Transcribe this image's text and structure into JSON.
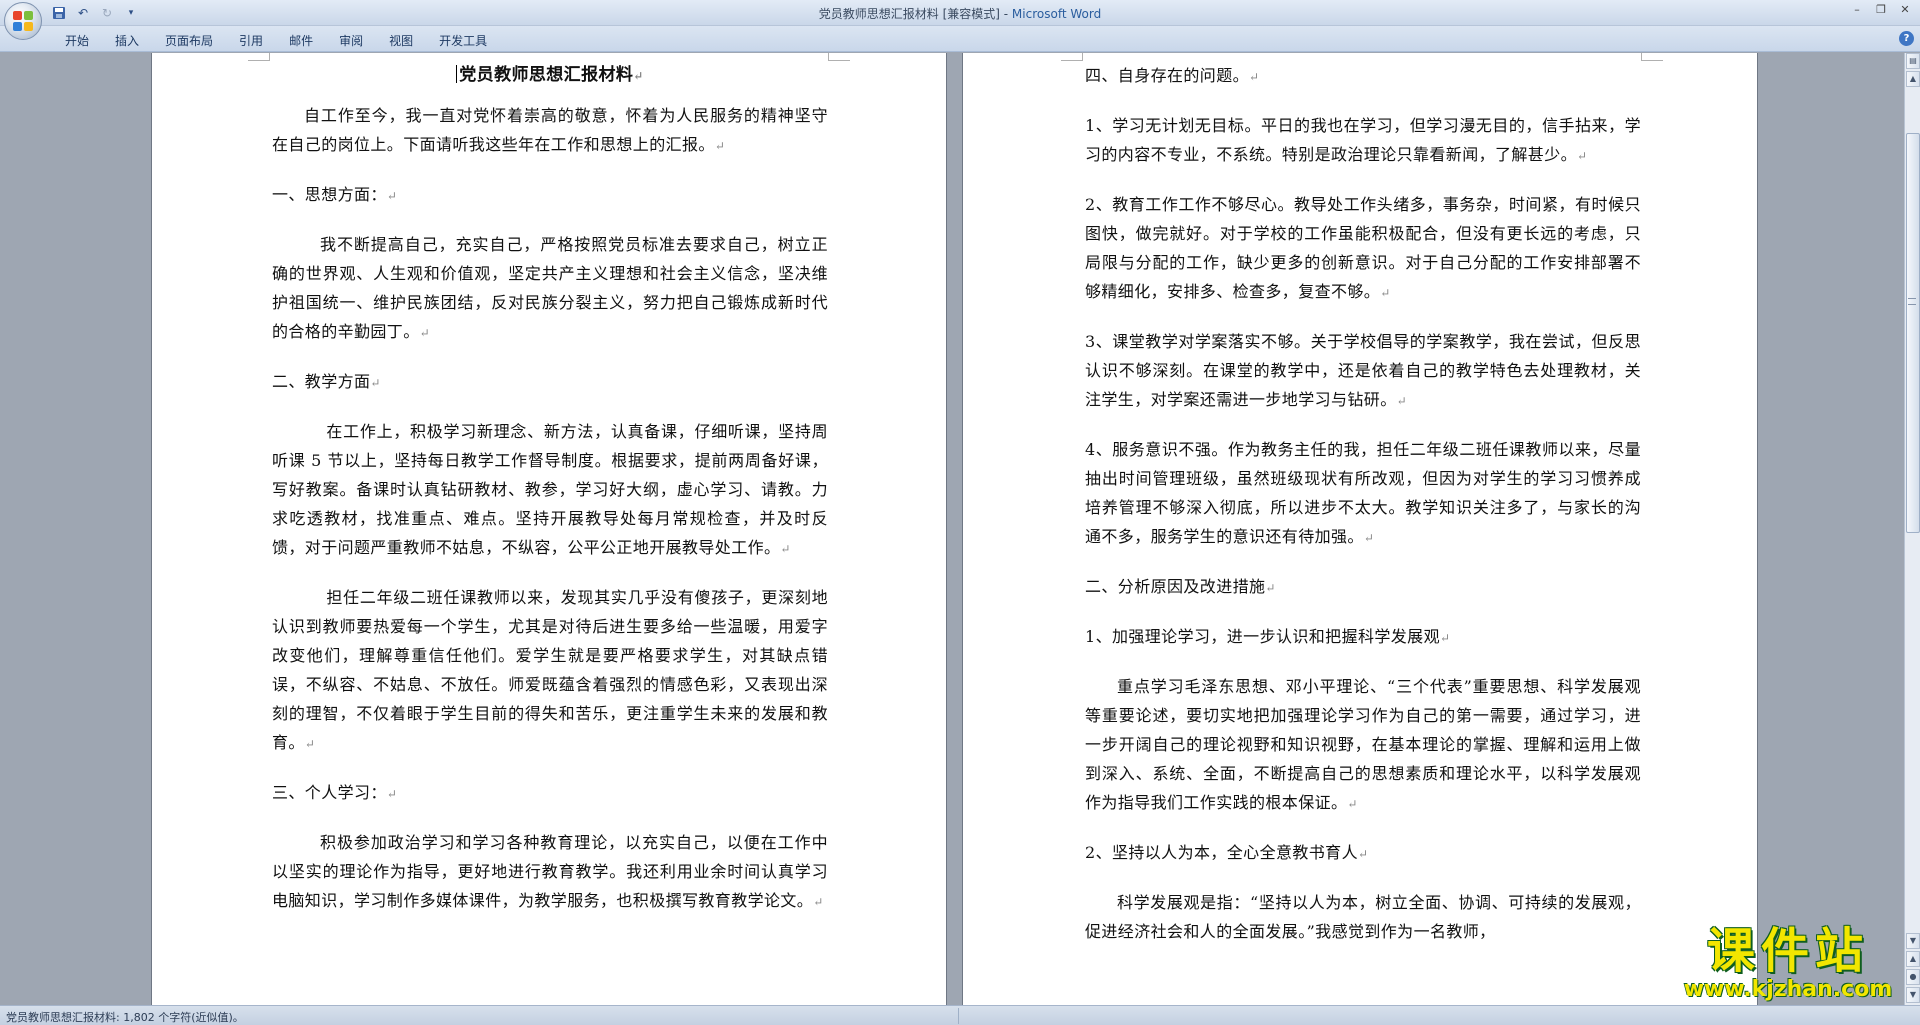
{
  "window": {
    "title_doc": "党员教师思想汇报材料 [兼容模式] - ",
    "title_app": "Microsoft Word"
  },
  "quick_access": {
    "save_icon": "save-icon",
    "undo_icon": "undo-icon",
    "redo_icon": "redo-icon",
    "customize_icon": "customize-qat-icon"
  },
  "ribbon": {
    "tabs": [
      "开始",
      "插入",
      "页面布局",
      "引用",
      "邮件",
      "审阅",
      "视图",
      "开发工具"
    ]
  },
  "status_bar": {
    "text": "党员教师思想汇报材料: 1,802 个字符(近似值)。"
  },
  "left_page": {
    "title": "党员教师思想汇报材料",
    "paragraphs": [
      "自工作至今，我一直对党怀着崇高的敬意，怀着为人民服务的精神坚守在自己的岗位上。下面请听我这些年在工作和思想上的汇报。",
      "一、思想方面：",
      "我不断提高自己，充实自己，严格按照党员标准去要求自己，树立正确的世界观、人生观和价值观，坚定共产主义理想和社会主义信念，坚决维护祖国统一、维护民族团结，反对民族分裂主义，努力把自己锻炼成新时代的合格的辛勤园丁。",
      "二、教学方面",
      "在工作上，积极学习新理念、新方法，认真备课，仔细听课，坚持周听课 5 节以上，坚持每日教学工作督导制度。根据要求，提前两周备好课，写好教案。备课时认真钻研教材、教参，学习好大纲，虚心学习、请教。力求吃透教材，找准重点、难点。坚持开展教导处每月常规检查，并及时反馈，对于问题严重教师不姑息，不纵容，公平公正地开展教导处工作。",
      "担任二年级二班任课教师以来，发现其实几乎没有傻孩子，更深刻地认识到教师要热爱每一个学生，尤其是对待后进生要多给一些温暖，用爱字改变他们，理解尊重信任他们。爱学生就是要严格要求学生，对其缺点错误，不纵容、不姑息、不放任。师爱既蕴含着强烈的情感色彩，又表现出深刻的理智，不仅着眼于学生目前的得失和苦乐，更注重学生未来的发展和教育。",
      "三、个人学习：",
      "积极参加政治学习和学习各种教育理论，以充实自己，以便在工作中以坚实的理论作为指导，更好地进行教育教学。我还利用业余时间认真学习电脑知识，学习制作多媒体课件，为教学服务，也积极撰写教育教学论文。"
    ]
  },
  "right_page": {
    "paragraphs": [
      "四、自身存在的问题。",
      "1、学习无计划无目标。平日的我也在学习，但学习漫无目的，信手拈来，学习的内容不专业，不系统。特别是政治理论只靠看新闻，了解甚少。",
      "2、教育工作工作不够尽心。教导处工作头绪多，事务杂，时间紧，有时候只图快，做完就好。对于学校的工作虽能积极配合，但没有更长远的考虑，只局限与分配的工作，缺少更多的创新意识。对于自己分配的工作安排部署不够精细化，安排多、检查多，复查不够。",
      "3、课堂教学对学案落实不够。关于学校倡导的学案教学，我在尝试，但反思认识不够深刻。在课堂的教学中，还是依着自己的教学特色去处理教材，关注学生，对学案还需进一步地学习与钻研。",
      "4、服务意识不强。作为教务主任的我，担任二年级二班任课教师以来，尽量抽出时间管理班级，虽然班级现状有所改观，但因为对学生的学习习惯养成培养管理不够深入彻底，所以进步不太大。教学知识关注多了，与家长的沟通不多，服务学生的意识还有待加强。",
      "二、分析原因及改进措施",
      "1、加强理论学习，进一步认识和把握科学发展观",
      "重点学习毛泽东思想、邓小平理论、“三个代表”重要思想、科学发展观等重要论述，要切实地把加强理论学习作为自己的第一需要，通过学习，进一步开阔自己的理论视野和知识视野，在基本理论的掌握、理解和运用上做到深入、系统、全面，不断提高自己的思想素质和理论水平，以科学发展观作为指导我们工作实践的根本保证。",
      "2、坚持以人为本，全心全意教书育人",
      "科学发展观是指：“坚持以人为本，树立全面、协调、可持续的发展观，促进经济社会和人的全面发展。”我感觉到作为一名教师，"
    ]
  },
  "watermark": {
    "main": "课件站",
    "url": "www.kjzhan.com"
  }
}
